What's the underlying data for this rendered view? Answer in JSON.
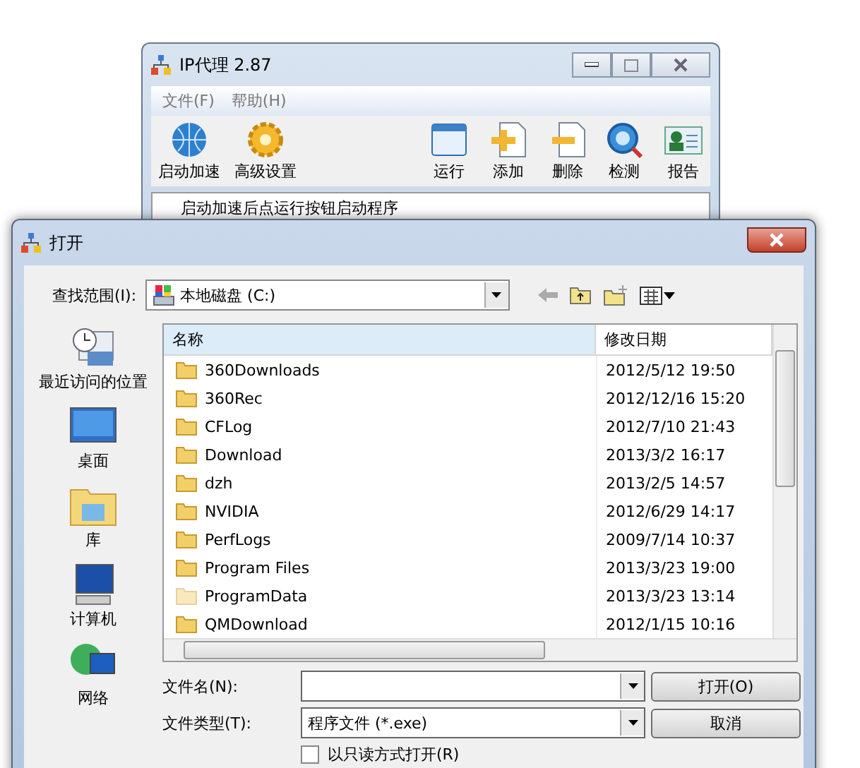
{
  "back_window": {
    "title": "IP代理 2.87",
    "menu": [
      "文件(F)",
      "帮助(H)"
    ],
    "toolbar": [
      {
        "kind": "globe",
        "label": "启动加速"
      },
      {
        "kind": "gear",
        "label": "高级设置"
      },
      {
        "kind": "window",
        "label": "运行"
      },
      {
        "kind": "add",
        "label": "添加"
      },
      {
        "kind": "remove",
        "label": "删除"
      },
      {
        "kind": "scan",
        "label": "检测"
      },
      {
        "kind": "report",
        "label": "报告"
      }
    ],
    "message": "启动加速后点运行按钮启动程序"
  },
  "dialog": {
    "title": "打开",
    "look_in_label": "查找范围(I):",
    "look_in_value": "本地磁盘 (C:)",
    "places": [
      {
        "kind": "recent",
        "label": "最近访问的位置"
      },
      {
        "kind": "desktop",
        "label": "桌面"
      },
      {
        "kind": "library",
        "label": "库"
      },
      {
        "kind": "computer",
        "label": "计算机"
      },
      {
        "kind": "network",
        "label": "网络"
      }
    ],
    "columns": [
      "名称",
      "修改日期"
    ],
    "rows": [
      {
        "name": "360Downloads",
        "date": "2012/5/12 19:50",
        "hidden": false
      },
      {
        "name": "360Rec",
        "date": "2012/12/16 15:20",
        "hidden": false
      },
      {
        "name": "CFLog",
        "date": "2012/7/10 21:43",
        "hidden": false
      },
      {
        "name": "Download",
        "date": "2013/3/2 16:17",
        "hidden": false
      },
      {
        "name": "dzh",
        "date": "2013/2/5 14:57",
        "hidden": false
      },
      {
        "name": "NVIDIA",
        "date": "2012/6/29 14:17",
        "hidden": false
      },
      {
        "name": "PerfLogs",
        "date": "2009/7/14 10:37",
        "hidden": false
      },
      {
        "name": "Program Files",
        "date": "2013/3/23 19:00",
        "hidden": false
      },
      {
        "name": "ProgramData",
        "date": "2013/3/23 13:14",
        "hidden": true
      },
      {
        "name": "QMDownload",
        "date": "2012/1/15 10:16",
        "hidden": false
      }
    ],
    "file_name_label": "文件名(N):",
    "file_type_label": "文件类型(T):",
    "file_type_value": "程序文件 (*.exe)",
    "open_button": "打开(O)",
    "cancel_button": "取消",
    "readonly": {
      "label": "以只读方式打开(R)",
      "checked": false
    }
  }
}
